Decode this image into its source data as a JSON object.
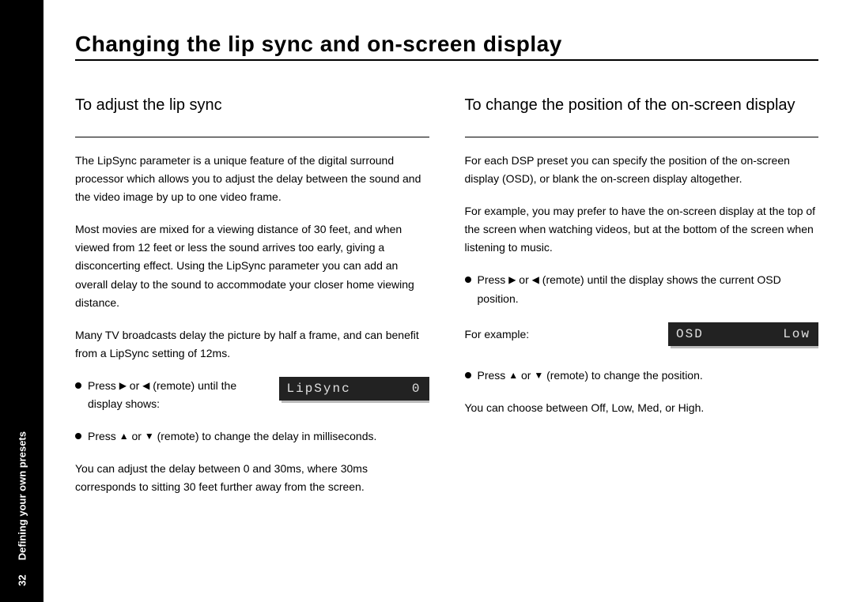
{
  "sidebar": {
    "page_number": "32",
    "section_label": "Defining your own presets"
  },
  "title": "Changing the lip sync and on-screen display",
  "left": {
    "heading": "To adjust the lip sync",
    "p1": "The LipSync parameter is a unique feature of the digital surround processor which allows you to adjust the delay between the sound and the video image by up to one video frame.",
    "p2": "Most movies are mixed for a viewing distance of 30 feet, and when viewed from 12 feet or less the sound arrives too early, giving a disconcerting effect. Using the LipSync parameter you can add an overall delay to the sound to accommodate your closer home viewing distance.",
    "p3": "Many TV broadcasts delay the picture by half a frame, and can benefit from a LipSync setting of 12ms.",
    "bullet1_pre": "Press ",
    "bullet1_post": " (remote) until the display shows:",
    "display_label": "LipSync",
    "display_value": "0",
    "bullet2_pre": "Press ",
    "bullet2_post": " (remote) to change the delay in milliseconds.",
    "p4": "You can adjust the delay between 0 and 30ms, where 30ms corresponds to sitting 30 feet further away from the screen."
  },
  "right": {
    "heading": "To change the position of the on-screen display",
    "p1": "For each DSP preset you can specify the position of the on-screen display (OSD), or blank the on-screen display altogether.",
    "p2": "For example, you may prefer to have the on-screen display at the top of the screen when watching videos, but at the bottom of the screen when listening to music.",
    "bullet1_pre": "Press ",
    "bullet1_post": " (remote) until the display shows the current OSD position.",
    "for_example": "For example:",
    "display_label": "OSD",
    "display_value": "Low",
    "bullet2_pre": "Press ",
    "bullet2_post": " (remote) to change the position.",
    "p3": "You can choose between Off, Low, Med, or High."
  },
  "glyphs": {
    "right": "▶",
    "left": "◀",
    "up": "▲",
    "down": "▼",
    "or": " or "
  }
}
